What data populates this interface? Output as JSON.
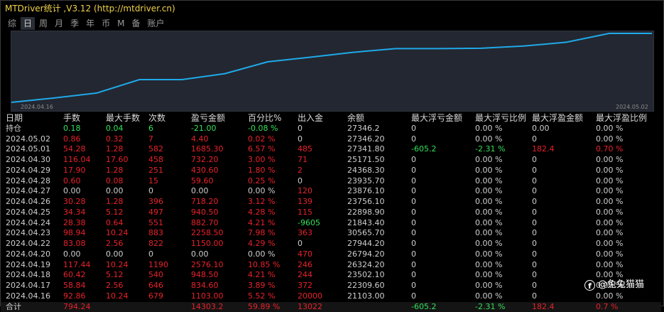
{
  "window": {
    "title": "MTDriver统计 ,V3.12 (http://mtdriver.cn)"
  },
  "tabs": [
    {
      "label": "综",
      "active": false
    },
    {
      "label": "日",
      "active": true
    },
    {
      "label": "周",
      "active": false
    },
    {
      "label": "月",
      "active": false
    },
    {
      "label": "季",
      "active": false
    },
    {
      "label": "年",
      "active": false
    },
    {
      "label": "币",
      "active": false
    },
    {
      "label": "M",
      "active": false
    },
    {
      "label": "备",
      "active": false
    },
    {
      "label": "账户",
      "active": false
    }
  ],
  "chart_data": {
    "type": "line",
    "x_start_label": "2024.04.16",
    "x_end_label": "2024.05.02",
    "x": [
      "2024.04.16",
      "2024.04.17",
      "2024.04.18",
      "2024.04.19",
      "2024.04.20",
      "2024.04.22",
      "2024.04.23",
      "2024.04.24",
      "2024.04.25",
      "2024.04.26",
      "2024.04.27",
      "2024.04.28",
      "2024.04.29",
      "2024.04.30",
      "2024.05.01",
      "2024.05.02"
    ],
    "values": [
      0,
      834.6,
      1783.1,
      4359.2,
      4359.2,
      5509.2,
      7767.7,
      8650.4,
      9590.9,
      10309.1,
      10309.1,
      10368.7,
      10799.3,
      11531.5,
      13216.8,
      13220.8
    ],
    "line_color": "#1fa9e8",
    "background": "#232731",
    "grid": false
  },
  "table": {
    "headers": [
      "日期",
      "手数",
      "最大手数",
      "次数",
      "盈亏金额",
      "百分比%",
      "出入金",
      "余额",
      "最大浮亏金额",
      "最大浮亏比例",
      "最大浮盈金额",
      "最大浮盈比例"
    ],
    "holding": {
      "cells": [
        "持仓",
        "0.18",
        "0.04",
        "6",
        "-21.00",
        "-0.08 %",
        "0",
        "27346.2",
        "0",
        "0.00 %",
        "0.00",
        "0.00 %"
      ],
      "colors": [
        "wht",
        "grn",
        "grn",
        "grn",
        "grn",
        "grn",
        "wht",
        "wht",
        "wht",
        "wht",
        "wht",
        "wht"
      ]
    },
    "rows": [
      {
        "cells": [
          "2024.05.02",
          "0.86",
          "0.32",
          "7",
          "4.40",
          "0.02 %",
          "0",
          "27346.20",
          "0",
          "0.00 %",
          "0",
          "0.00 %"
        ],
        "colors": [
          "wht",
          "red",
          "red",
          "red",
          "red",
          "red",
          "wht",
          "wht",
          "wht",
          "wht",
          "wht",
          "wht"
        ]
      },
      {
        "cells": [
          "2024.05.01",
          "54.28",
          "1.28",
          "582",
          "1685.30",
          "6.57 %",
          "485",
          "27341.80",
          "-605.2",
          "-2.31 %",
          "182.4",
          "0.70 %"
        ],
        "colors": [
          "wht",
          "red",
          "red",
          "red",
          "red",
          "red",
          "red",
          "wht",
          "grn",
          "grn",
          "red",
          "red"
        ]
      },
      {
        "cells": [
          "2024.04.30",
          "116.04",
          "17.60",
          "458",
          "732.20",
          "3.00 %",
          "71",
          "25171.50",
          "0",
          "0.00 %",
          "0",
          "0.00 %"
        ],
        "colors": [
          "wht",
          "red",
          "red",
          "red",
          "red",
          "red",
          "red",
          "wht",
          "wht",
          "wht",
          "wht",
          "wht"
        ]
      },
      {
        "cells": [
          "2024.04.29",
          "17.90",
          "1.28",
          "251",
          "430.60",
          "1.80 %",
          "2",
          "24368.30",
          "0",
          "0.00 %",
          "0",
          "0.00 %"
        ],
        "colors": [
          "wht",
          "red",
          "red",
          "red",
          "red",
          "red",
          "red",
          "wht",
          "wht",
          "wht",
          "wht",
          "wht"
        ]
      },
      {
        "cells": [
          "2024.04.28",
          "0.60",
          "0.08",
          "15",
          "59.60",
          "0.25 %",
          "0",
          "23935.70",
          "0",
          "0.00 %",
          "0",
          "0.00 %"
        ],
        "colors": [
          "wht",
          "red",
          "red",
          "red",
          "red",
          "red",
          "wht",
          "wht",
          "wht",
          "wht",
          "wht",
          "wht"
        ]
      },
      {
        "cells": [
          "2024.04.27",
          "0.00",
          "0.00",
          "0",
          "0.00",
          "0.00 %",
          "120",
          "23876.10",
          "0",
          "0.00 %",
          "0",
          "0.00 %"
        ],
        "colors": [
          "wht",
          "wht",
          "wht",
          "wht",
          "wht",
          "wht",
          "red",
          "wht",
          "wht",
          "wht",
          "wht",
          "wht"
        ]
      },
      {
        "cells": [
          "2024.04.26",
          "30.28",
          "1.28",
          "396",
          "718.20",
          "3.12 %",
          "139",
          "23756.10",
          "0",
          "0.00 %",
          "0",
          "0.00 %"
        ],
        "colors": [
          "wht",
          "red",
          "red",
          "red",
          "red",
          "red",
          "red",
          "wht",
          "wht",
          "wht",
          "wht",
          "wht"
        ]
      },
      {
        "cells": [
          "2024.04.25",
          "34.34",
          "5.12",
          "497",
          "940.50",
          "4.28 %",
          "115",
          "22898.90",
          "0",
          "0.00 %",
          "0",
          "0.00 %"
        ],
        "colors": [
          "wht",
          "red",
          "red",
          "red",
          "red",
          "red",
          "red",
          "wht",
          "wht",
          "wht",
          "wht",
          "wht"
        ]
      },
      {
        "cells": [
          "2024.04.24",
          "28.38",
          "0.64",
          "551",
          "882.70",
          "4.21 %",
          "-9605",
          "21843.40",
          "0",
          "0.00 %",
          "0",
          "0.00 %"
        ],
        "colors": [
          "wht",
          "red",
          "red",
          "red",
          "red",
          "red",
          "grn",
          "wht",
          "wht",
          "wht",
          "wht",
          "wht"
        ]
      },
      {
        "cells": [
          "2024.04.23",
          "98.94",
          "10.24",
          "883",
          "2258.50",
          "7.98 %",
          "363",
          "30565.70",
          "0",
          "0.00 %",
          "0",
          "0.00 %"
        ],
        "colors": [
          "wht",
          "red",
          "red",
          "red",
          "red",
          "red",
          "red",
          "wht",
          "wht",
          "wht",
          "wht",
          "wht"
        ]
      },
      {
        "cells": [
          "2024.04.22",
          "83.08",
          "2.56",
          "822",
          "1150.00",
          "4.29 %",
          "0",
          "27944.20",
          "0",
          "0.00 %",
          "0",
          "0.00 %"
        ],
        "colors": [
          "wht",
          "red",
          "red",
          "red",
          "red",
          "red",
          "wht",
          "wht",
          "wht",
          "wht",
          "wht",
          "wht"
        ]
      },
      {
        "cells": [
          "2024.04.20",
          "0.00",
          "0.00",
          "0",
          "0.00",
          "0.00 %",
          "470",
          "26794.20",
          "0",
          "0.00 %",
          "0",
          "0.00 %"
        ],
        "colors": [
          "wht",
          "wht",
          "wht",
          "wht",
          "wht",
          "wht",
          "red",
          "wht",
          "wht",
          "wht",
          "wht",
          "wht"
        ]
      },
      {
        "cells": [
          "2024.04.19",
          "117.44",
          "10.24",
          "1190",
          "2576.10",
          "10.85 %",
          "246",
          "26324.20",
          "0",
          "0.00 %",
          "0",
          "0.00 %"
        ],
        "colors": [
          "wht",
          "red",
          "red",
          "red",
          "red",
          "red",
          "red",
          "wht",
          "wht",
          "wht",
          "wht",
          "wht"
        ]
      },
      {
        "cells": [
          "2024.04.18",
          "60.42",
          "5.12",
          "540",
          "948.50",
          "4.21 %",
          "244",
          "23502.10",
          "0",
          "0.00 %",
          "0",
          "0.00 %"
        ],
        "colors": [
          "wht",
          "red",
          "red",
          "red",
          "red",
          "red",
          "red",
          "wht",
          "wht",
          "wht",
          "wht",
          "wht"
        ]
      },
      {
        "cells": [
          "2024.04.17",
          "58.84",
          "2.56",
          "646",
          "834.60",
          "3.89 %",
          "372",
          "22309.60",
          "0",
          "0.00 %",
          "0",
          "0.00 %"
        ],
        "colors": [
          "wht",
          "red",
          "red",
          "red",
          "red",
          "red",
          "red",
          "wht",
          "wht",
          "wht",
          "wht",
          "wht"
        ]
      },
      {
        "cells": [
          "2024.04.16",
          "92.86",
          "10.24",
          "679",
          "1103.00",
          "5.52 %",
          "20000",
          "21103.00",
          "0",
          "0.00 %",
          "0",
          "0.00 %"
        ],
        "colors": [
          "wht",
          "red",
          "red",
          "red",
          "red",
          "red",
          "red",
          "wht",
          "wht",
          "wht",
          "wht",
          "wht"
        ]
      }
    ],
    "total": {
      "cells": [
        "合计",
        "794.24",
        "",
        "",
        "14303.2",
        "59.89 %",
        "13022",
        "",
        "-605.2",
        "-2.31 %",
        "182.4",
        "0.7 %"
      ],
      "colors": [
        "wht",
        "red",
        "red",
        "red",
        "red",
        "red",
        "red",
        "wht",
        "grn",
        "grn",
        "red",
        "red"
      ]
    }
  },
  "watermark": {
    "icon": "facebook-icon",
    "text": "@兔兔猫猫"
  }
}
